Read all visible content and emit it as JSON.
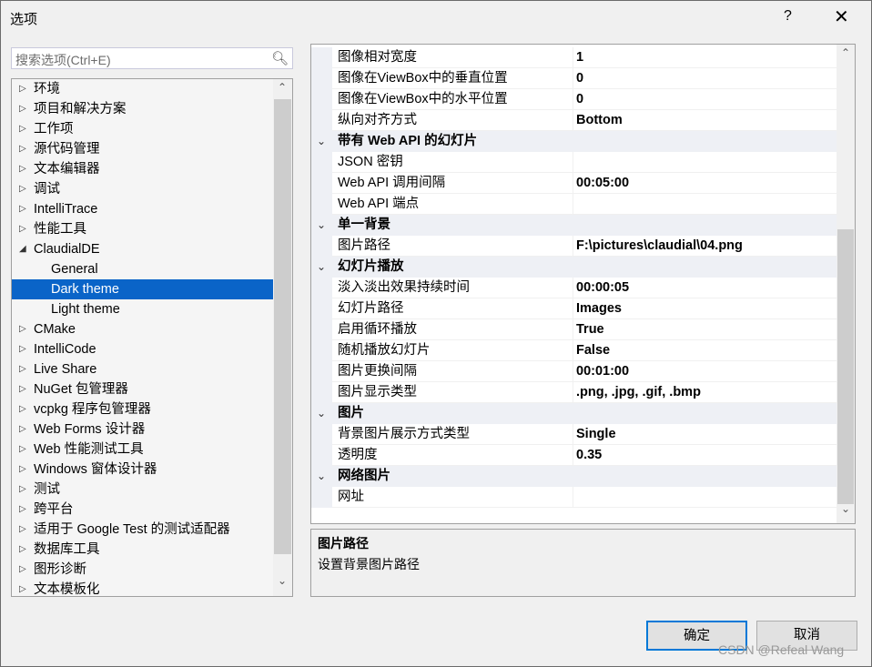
{
  "window": {
    "title": "选项",
    "help": "?",
    "close": "✕"
  },
  "search": {
    "placeholder": "搜索选项(Ctrl+E)",
    "icon": "search-icon"
  },
  "tree": [
    {
      "label": "环境",
      "state": "collapsed"
    },
    {
      "label": "项目和解决方案",
      "state": "collapsed"
    },
    {
      "label": "工作项",
      "state": "collapsed"
    },
    {
      "label": "源代码管理",
      "state": "collapsed"
    },
    {
      "label": "文本编辑器",
      "state": "collapsed"
    },
    {
      "label": "调试",
      "state": "collapsed"
    },
    {
      "label": "IntelliTrace",
      "state": "collapsed"
    },
    {
      "label": "性能工具",
      "state": "collapsed"
    },
    {
      "label": "ClaudialDE",
      "state": "expanded"
    },
    {
      "label": "General",
      "state": "child"
    },
    {
      "label": "Dark theme",
      "state": "child",
      "selected": true
    },
    {
      "label": "Light theme",
      "state": "child"
    },
    {
      "label": "CMake",
      "state": "collapsed"
    },
    {
      "label": "IntelliCode",
      "state": "collapsed"
    },
    {
      "label": "Live Share",
      "state": "collapsed"
    },
    {
      "label": "NuGet 包管理器",
      "state": "collapsed"
    },
    {
      "label": "vcpkg 程序包管理器",
      "state": "collapsed"
    },
    {
      "label": "Web Forms 设计器",
      "state": "collapsed"
    },
    {
      "label": "Web 性能测试工具",
      "state": "collapsed"
    },
    {
      "label": "Windows 窗体设计器",
      "state": "collapsed"
    },
    {
      "label": "测试",
      "state": "collapsed"
    },
    {
      "label": "跨平台",
      "state": "collapsed"
    },
    {
      "label": "适用于 Google Test 的测试适配器",
      "state": "collapsed"
    },
    {
      "label": "数据库工具",
      "state": "collapsed"
    },
    {
      "label": "图形诊断",
      "state": "collapsed"
    },
    {
      "label": "文本模板化",
      "state": "collapsed"
    }
  ],
  "grid": [
    {
      "type": "prop",
      "name": "图像相对宽度",
      "value": "1"
    },
    {
      "type": "prop",
      "name": "图像在ViewBox中的垂直位置",
      "value": "0"
    },
    {
      "type": "prop",
      "name": "图像在ViewBox中的水平位置",
      "value": "0"
    },
    {
      "type": "prop",
      "name": "纵向对齐方式",
      "value": "Bottom"
    },
    {
      "type": "cat",
      "name": "带有 Web API 的幻灯片"
    },
    {
      "type": "prop",
      "name": "JSON 密钥",
      "value": ""
    },
    {
      "type": "prop",
      "name": "Web API 调用间隔",
      "value": "00:05:00"
    },
    {
      "type": "prop",
      "name": "Web API 端点",
      "value": ""
    },
    {
      "type": "cat",
      "name": "单一背景"
    },
    {
      "type": "prop",
      "name": "图片路径",
      "value": "F:\\pictures\\claudial\\04.png"
    },
    {
      "type": "cat",
      "name": "幻灯片播放"
    },
    {
      "type": "prop",
      "name": "淡入淡出效果持续时间",
      "value": "00:00:05"
    },
    {
      "type": "prop",
      "name": "幻灯片路径",
      "value": "Images"
    },
    {
      "type": "prop",
      "name": "启用循环播放",
      "value": "True"
    },
    {
      "type": "prop",
      "name": "随机播放幻灯片",
      "value": "False"
    },
    {
      "type": "prop",
      "name": "图片更换间隔",
      "value": "00:01:00"
    },
    {
      "type": "prop",
      "name": "图片显示类型",
      "value": ".png, .jpg, .gif, .bmp"
    },
    {
      "type": "cat",
      "name": "图片"
    },
    {
      "type": "prop",
      "name": "背景图片展示方式类型",
      "value": "Single"
    },
    {
      "type": "prop",
      "name": "透明度",
      "value": "0.35"
    },
    {
      "type": "cat",
      "name": "网络图片"
    },
    {
      "type": "prop",
      "name": "网址",
      "value": ""
    }
  ],
  "description": {
    "title": "图片路径",
    "text": "设置背景图片路径"
  },
  "buttons": {
    "ok": "确定",
    "cancel": "取消"
  },
  "watermark": "CSDN @Refeal Wang",
  "colors": {
    "selection": "#0a64c8",
    "accent": "#0078d7"
  }
}
